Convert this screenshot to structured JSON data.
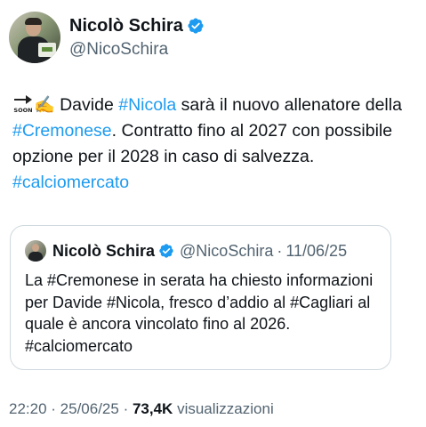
{
  "author": {
    "name": "Nicolò Schira",
    "handle": "@NicoSchira"
  },
  "tweet": {
    "icons": [
      "soon-arrow-icon",
      "writing-hand-icon"
    ],
    "segments": [
      {
        "text": "Davide ",
        "tag": false
      },
      {
        "text": "#Nicola",
        "tag": true
      },
      {
        "text": " sarà il nuovo allenatore della ",
        "tag": false
      },
      {
        "text": "#Cremonese",
        "tag": true
      },
      {
        "text": ". Contratto fino al 2027 con possibile opzione per il 2028 in caso di salvezza. ",
        "tag": false
      },
      {
        "text": "#calciomercato",
        "tag": true
      }
    ]
  },
  "quote": {
    "name": "Nicolò Schira",
    "handle": "@NicoSchira",
    "separator": "·",
    "date": "11/06/25",
    "text": "La #Cremonese in serata ha chiesto informazioni per Davide #Nicola, fresco d’addio al #Cagliari al quale è ancora vincolato fino al 2026. #calciomercato"
  },
  "footer": {
    "time": "22:20",
    "separator": " · ",
    "date": "25/06/25",
    "views": "73,4K",
    "views_label": "visualizzazioni"
  },
  "colors": {
    "link": "#1d9bf0",
    "verified": "#1d9bf0",
    "muted": "#536471",
    "text": "#0f1419"
  }
}
